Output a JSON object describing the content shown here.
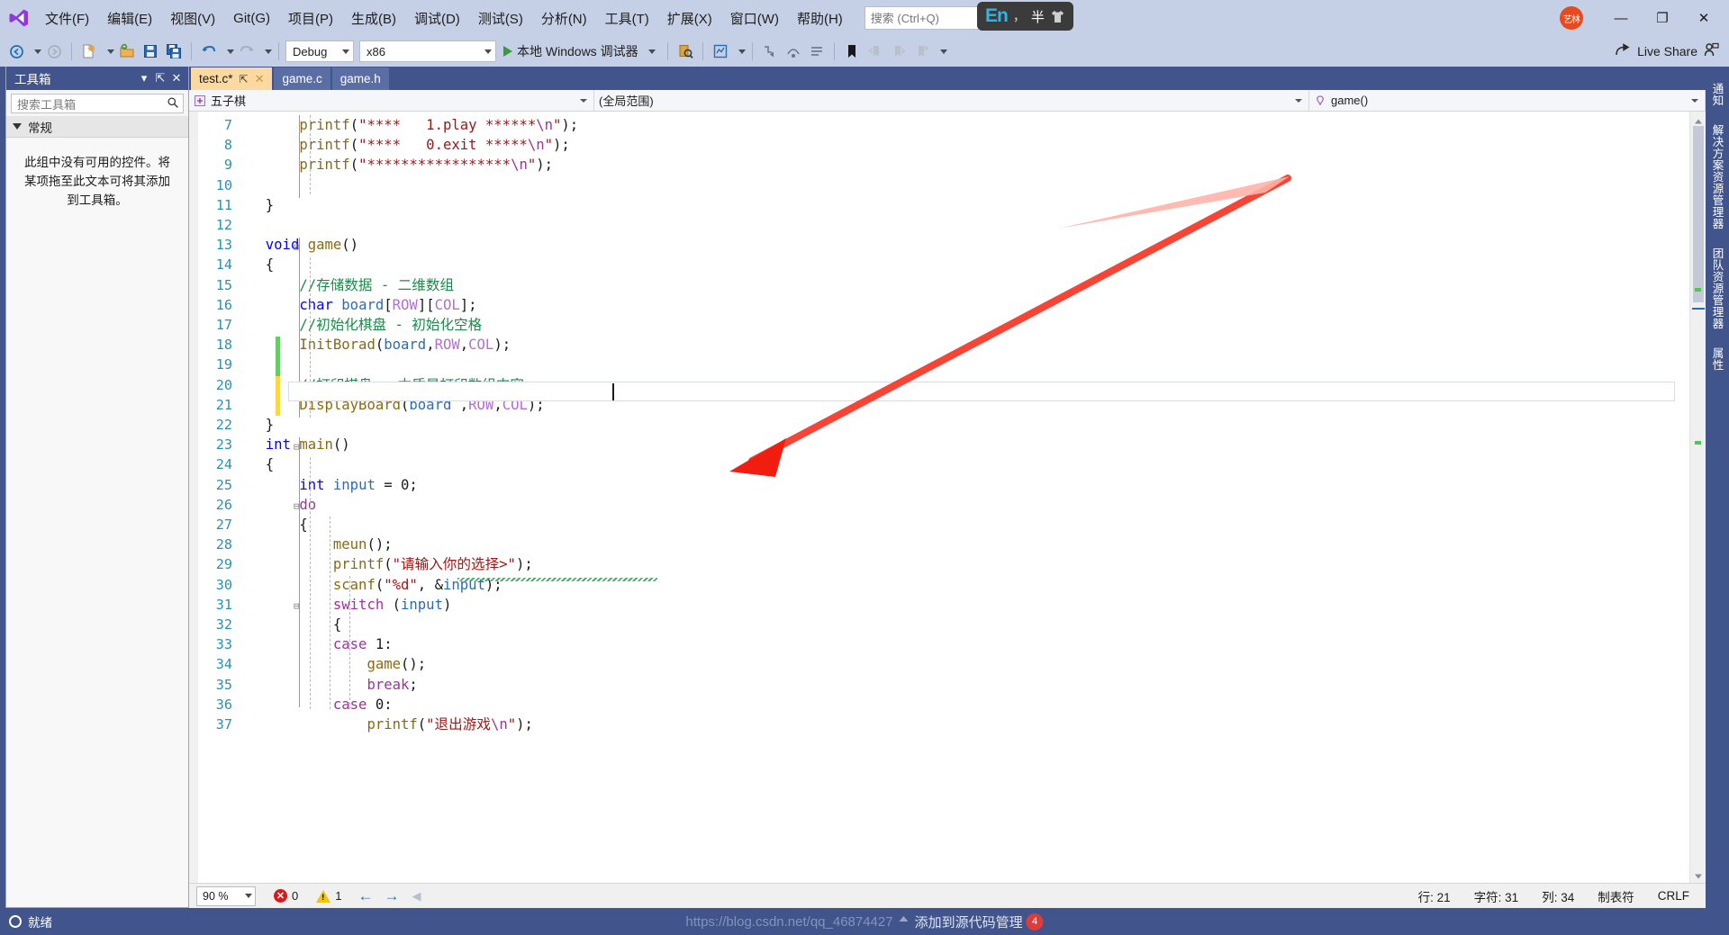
{
  "window": {
    "menu": [
      {
        "label": "文件(F)"
      },
      {
        "label": "编辑(E)"
      },
      {
        "label": "视图(V)"
      },
      {
        "label": "Git(G)"
      },
      {
        "label": "项目(P)"
      },
      {
        "label": "生成(B)"
      },
      {
        "label": "调试(D)"
      },
      {
        "label": "测试(S)"
      },
      {
        "label": "分析(N)"
      },
      {
        "label": "工具(T)"
      },
      {
        "label": "扩展(X)"
      },
      {
        "label": "窗口(W)"
      },
      {
        "label": "帮助(H)"
      }
    ],
    "search_placeholder": "搜索 (Ctrl+Q)",
    "ime": {
      "lang": "En",
      "punct": "，",
      "width": "半"
    },
    "avatar_initials": "艺林",
    "minimize": "—",
    "maximize": "❐",
    "close": "✕"
  },
  "toolbar": {
    "config": "Debug",
    "platform": "x86",
    "run_label": "本地 Windows 调试器",
    "live_share": "Live Share"
  },
  "toolbox": {
    "title": "工具箱",
    "search_placeholder": "搜索工具箱",
    "group": "常规",
    "empty_text": "此组中没有可用的控件。将某项拖至此文本可将其添加到工具箱。"
  },
  "tabs": [
    {
      "label": "test.c*",
      "active": true,
      "pinned": true,
      "closable": true
    },
    {
      "label": "game.c",
      "active": false
    },
    {
      "label": "game.h",
      "active": false
    }
  ],
  "navbar": {
    "project": "五子棋",
    "scope": "(全局范围)",
    "member": "game()"
  },
  "editor": {
    "lines": [
      {
        "n": 7,
        "text": "      printf(\"****   1.play ******\\n\");"
      },
      {
        "n": 8,
        "text": "      printf(\"****   0.exit *****\\n\");"
      },
      {
        "n": 9,
        "text": "      printf(\"*****************\\n\");"
      },
      {
        "n": 10,
        "text": ""
      },
      {
        "n": 11,
        "text": "}"
      },
      {
        "n": 12,
        "text": ""
      },
      {
        "n": 13,
        "text": "void game()"
      },
      {
        "n": 14,
        "text": "{"
      },
      {
        "n": 15,
        "text": "    //存储数据 - 二维数组"
      },
      {
        "n": 16,
        "text": "    char board[ROW][COL];"
      },
      {
        "n": 17,
        "text": "    //初始化棋盘 - 初始化空格"
      },
      {
        "n": 18,
        "text": "    InitBorad(board,ROW,COL);"
      },
      {
        "n": 19,
        "text": ""
      },
      {
        "n": 20,
        "text": "    //打印棋盘 - 本质是打印数组内容"
      },
      {
        "n": 21,
        "text": "    DisplayBoard(board ,ROW,COL);"
      },
      {
        "n": 22,
        "text": "}"
      },
      {
        "n": 23,
        "text": "int main()"
      },
      {
        "n": 24,
        "text": "{"
      },
      {
        "n": 25,
        "text": "    int input = 0;"
      },
      {
        "n": 26,
        "text": "    do"
      },
      {
        "n": 27,
        "text": "    {"
      },
      {
        "n": 28,
        "text": "        meun();"
      },
      {
        "n": 29,
        "text": "        printf(\"请输入你的选择>\");"
      },
      {
        "n": 30,
        "text": "        scanf(\"%d\", &input);"
      },
      {
        "n": 31,
        "text": "        switch (input)"
      },
      {
        "n": 32,
        "text": "        {"
      },
      {
        "n": 33,
        "text": "        case 1:"
      },
      {
        "n": 34,
        "text": "            game();"
      },
      {
        "n": 35,
        "text": "            break;"
      },
      {
        "n": 36,
        "text": "        case 0:"
      },
      {
        "n": 37,
        "text": "            printf(\"退出游戏\\n\");"
      }
    ],
    "current_line": 21
  },
  "editor_status": {
    "zoom": "90 %",
    "errors": "0",
    "warnings": "1",
    "line_label": "行: 21",
    "char_label": "字符: 31",
    "col_label": "列: 34",
    "tabs_label": "制表符",
    "eol_label": "CRLF"
  },
  "statusbar": {
    "ready": "就绪",
    "add_to_source": "添加到源代码管理",
    "watermark_url": "https://blog.csdn.net/qq_46874427",
    "badge": "4"
  },
  "rightdock": {
    "tabs": [
      "通知",
      "解决方案资源管理器",
      "团队资源管理器",
      "属性"
    ]
  },
  "colors": {
    "accent": "#41558c",
    "titlebar": "#c5cfe5",
    "active_tab": "#fcd9a0",
    "comment": "#1d8a4a",
    "keyword": "#0000ff",
    "string": "#a31515",
    "macro": "#b36fd0",
    "arrow": "#f22613"
  }
}
